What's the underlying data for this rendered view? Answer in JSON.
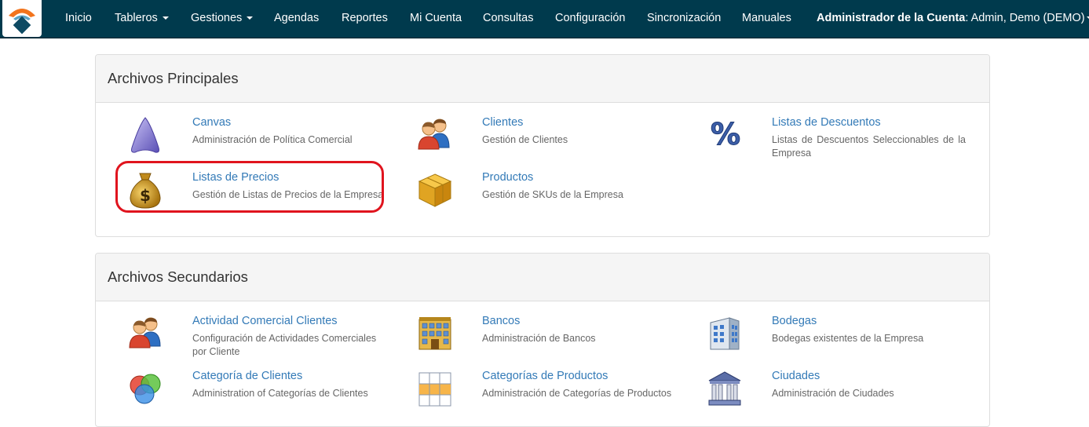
{
  "nav": {
    "items": [
      {
        "label": "Inicio",
        "dropdown": false
      },
      {
        "label": "Tableros",
        "dropdown": true
      },
      {
        "label": "Gestiones",
        "dropdown": true
      },
      {
        "label": "Agendas",
        "dropdown": false
      },
      {
        "label": "Reportes",
        "dropdown": false
      },
      {
        "label": "Mi Cuenta",
        "dropdown": false
      },
      {
        "label": "Consultas",
        "dropdown": false
      },
      {
        "label": "Configuración",
        "dropdown": false
      },
      {
        "label": "Sincronización",
        "dropdown": false
      },
      {
        "label": "Manuales",
        "dropdown": false
      }
    ],
    "account_role": "Administrador de la Cuenta",
    "account_user": ": Admin, Demo (DEMO)"
  },
  "principales": {
    "title": "Archivos Principales",
    "entries": [
      {
        "title": "Canvas",
        "desc": "Administración de Política Comercial",
        "icon": "canvas-icon"
      },
      {
        "title": "Clientes",
        "desc": "Gestión de Clientes",
        "icon": "users-icon"
      },
      {
        "title": "Listas de Descuentos",
        "desc": "Listas de Descuentos Seleccionables de la Empresa",
        "icon": "percent-icon"
      },
      {
        "title": "Listas de Precios",
        "desc": "Gestión de Listas de Precios de la Empresa",
        "icon": "money-bag-icon"
      },
      {
        "title": "Productos",
        "desc": "Gestión de SKUs de la Empresa",
        "icon": "box-icon"
      }
    ]
  },
  "secundarios": {
    "title": "Archivos Secundarios",
    "entries": [
      {
        "title": "Actividad Comercial Clientes",
        "desc": "Configuración de Actividades Comerciales por Cliente",
        "icon": "users-icon"
      },
      {
        "title": "Bancos",
        "desc": "Administración de Bancos",
        "icon": "bank-building-icon"
      },
      {
        "title": "Bodegas",
        "desc": "Bodegas existentes de la Empresa",
        "icon": "warehouse-building-icon"
      },
      {
        "title": "Categoría de Clientes",
        "desc": "Administration of Categorías de Clientes",
        "icon": "venn-circles-icon"
      },
      {
        "title": "Categorías de Productos",
        "desc": "Administración de Categorías de Productos",
        "icon": "grid-table-icon"
      },
      {
        "title": "Ciudades",
        "desc": "Administración de Ciudades",
        "icon": "city-hall-icon"
      }
    ]
  },
  "colors": {
    "navbar": "#003a4d",
    "link": "#337ab7",
    "highlight": "#e0141e"
  }
}
